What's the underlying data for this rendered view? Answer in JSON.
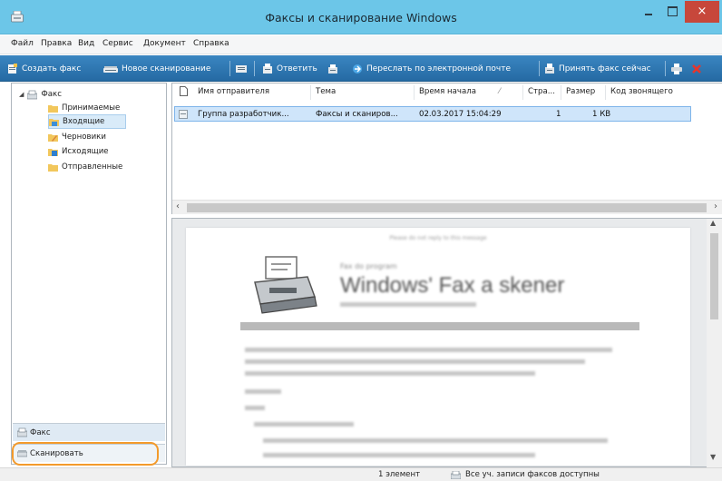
{
  "window": {
    "title": "Факсы и сканирование Windows",
    "close_glyph": "×"
  },
  "menu": [
    "Файл",
    "Правка",
    "Вид",
    "Сервис",
    "Документ",
    "Справка"
  ],
  "toolbar": {
    "new_fax": "Создать факс",
    "new_scan": "Новое сканирование",
    "reply": "Ответить",
    "forward_email": "Переслать по электронной почте",
    "receive_fax": "Принять факс сейчас"
  },
  "nav": {
    "root": "Факс",
    "folders": [
      "Принимаемые",
      "Входящие",
      "Черновики",
      "Исходящие",
      "Отправленные"
    ],
    "selected_folder": "Входящие",
    "bottom_buttons": [
      "Факс",
      "Сканировать"
    ]
  },
  "list": {
    "columns": [
      "Имя отправителя",
      "Тема",
      "Время начала",
      "Стра...",
      "Размер",
      "Код звонящего"
    ],
    "sort_indicator": "⁄",
    "rows": [
      {
        "sender": "Группа разработчик...",
        "subject": "Факсы и сканиров...",
        "start_time": "02.03.2017 15:04:29",
        "pages": "1",
        "size": "1 КВ",
        "caller_id": ""
      }
    ]
  },
  "preview": {
    "note": "Please do not reply to this message",
    "heading_small": "Fax do program",
    "heading_big": "Windows' Fax a skener"
  },
  "status": {
    "count": "1 элемент",
    "message": "Все уч. записи факсов доступны"
  },
  "colors": {
    "titlebar": "#6cc6e8",
    "toolbar": "#2f78b5",
    "selection": "#cfe5fa",
    "highlight_ring": "#f39a2b",
    "close_button": "#c7473b"
  }
}
